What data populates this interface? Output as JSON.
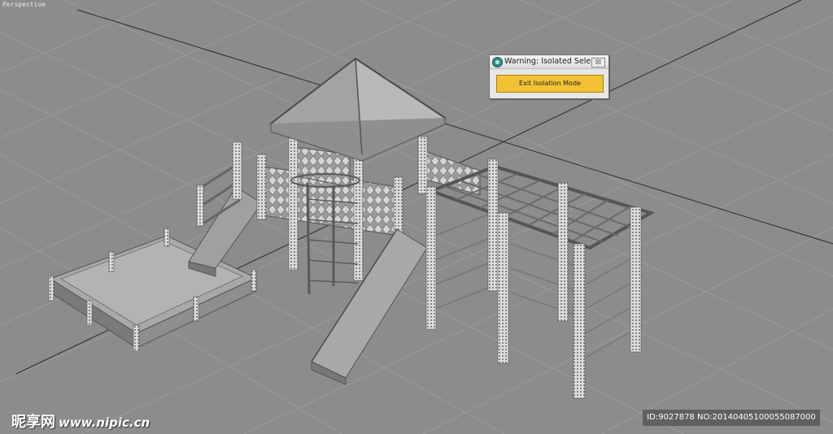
{
  "viewport": {
    "label": "Perspective"
  },
  "dialog": {
    "title": "Warning: Isolated Sele...",
    "close_glyph": "☒",
    "button_label": "Exit Isolation Mode",
    "icon": "3ds-max-app-icon"
  },
  "watermark": {
    "brand": "昵享网",
    "url": "www.nipic.cn"
  },
  "image_info": {
    "text": "ID:9027878 NO:20140405100055087000"
  },
  "colors": {
    "viewport_bg": "#8c8c8c",
    "button_accent": "#f2c234"
  }
}
